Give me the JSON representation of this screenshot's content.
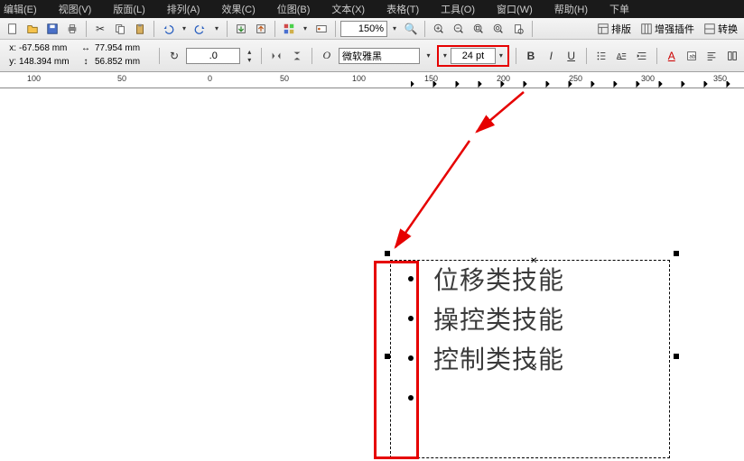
{
  "menu": {
    "items": [
      "编辑(E)",
      "视图(V)",
      "版面(L)",
      "排列(A)",
      "效果(C)",
      "位图(B)",
      "文本(X)",
      "表格(T)",
      "工具(O)",
      "窗口(W)",
      "帮助(H)",
      "下单"
    ]
  },
  "coords": {
    "xlabel": "x:",
    "xval": "-67.568 mm",
    "ylabel": "y:",
    "yval": "148.394 mm",
    "wval": "77.954 mm",
    "hval": "56.852 mm"
  },
  "rotate": {
    "val": ".0"
  },
  "zoom": {
    "val": "150%"
  },
  "font": {
    "family": "微软雅黑",
    "size": "24 pt"
  },
  "rightbar": {
    "a": "排版",
    "b": "增强插件",
    "c": "转换"
  },
  "ruler": {
    "marks": [
      "100",
      "50",
      "0",
      "50",
      "100",
      "150",
      "200",
      "250",
      "300",
      "350"
    ]
  },
  "text": {
    "lines": [
      "位移类技能",
      "操控类技能",
      "控制类技能"
    ]
  }
}
